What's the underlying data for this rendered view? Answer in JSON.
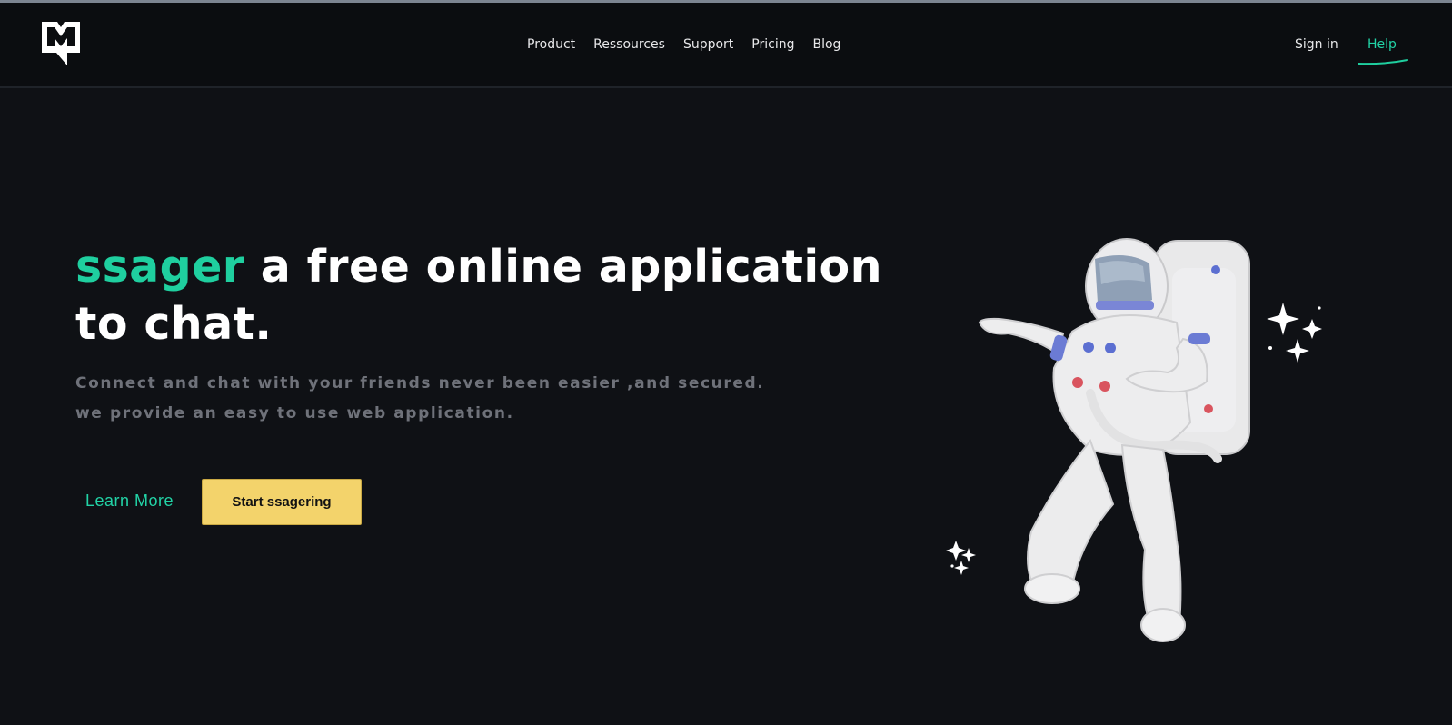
{
  "nav": {
    "brand_icon": "message-bookmark-logo-icon",
    "links": [
      "Product",
      "Ressources",
      "Support",
      "Pricing",
      "Blog"
    ],
    "sign_in": "Sign in",
    "help": "Help"
  },
  "hero": {
    "title_accent": "ssager",
    "title_rest": " a free online application to chat.",
    "subtitle": "Connect and chat with your friends never been easier ,and secured. we provide an easy to use web application.",
    "learn_more": "Learn More",
    "cta": "Start ssagering"
  },
  "colors": {
    "background": "#0f1115",
    "navbar": "#0b0d10",
    "accent": "#1fcf9f",
    "cta": "#f3d36b",
    "subtitle": "#6f727a"
  },
  "illustration": "astronaut-illustration"
}
